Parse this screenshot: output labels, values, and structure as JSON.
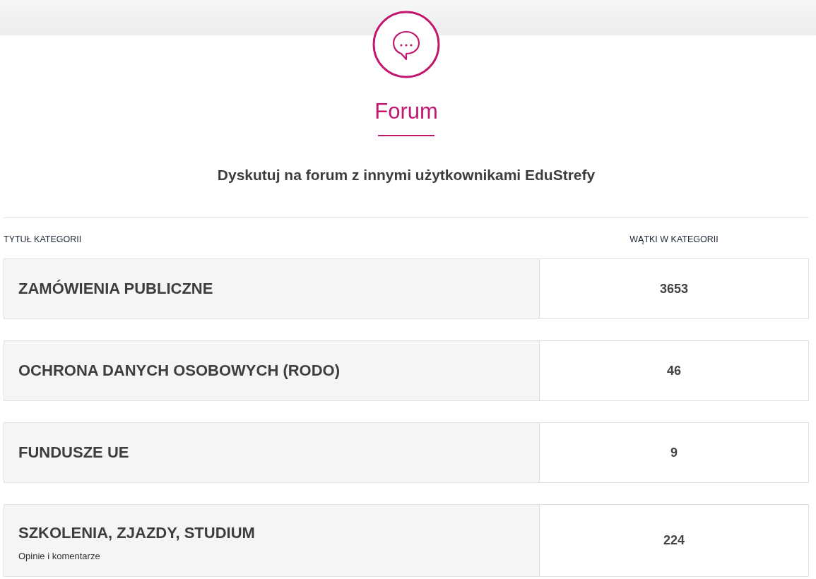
{
  "header": {
    "title": "Forum",
    "subtitle": "Dyskutuj na forum z innymi użytkownikami EduStrefy"
  },
  "table": {
    "columns": [
      "TYTUŁ KATEGORII",
      "WĄTKI W KATEGORII"
    ],
    "rows": [
      {
        "title": "ZAMÓWIENIA PUBLICZNE",
        "threads": "3653"
      },
      {
        "title": "OCHRONA DANYCH OSOBOWYCH (RODO)",
        "threads": "46"
      },
      {
        "title": "FUNDUSZE UE",
        "threads": "9"
      },
      {
        "title": "SZKOLENIA, ZJAZDY, STUDIUM",
        "description": "Opinie i komentarze",
        "threads": "224"
      }
    ]
  }
}
